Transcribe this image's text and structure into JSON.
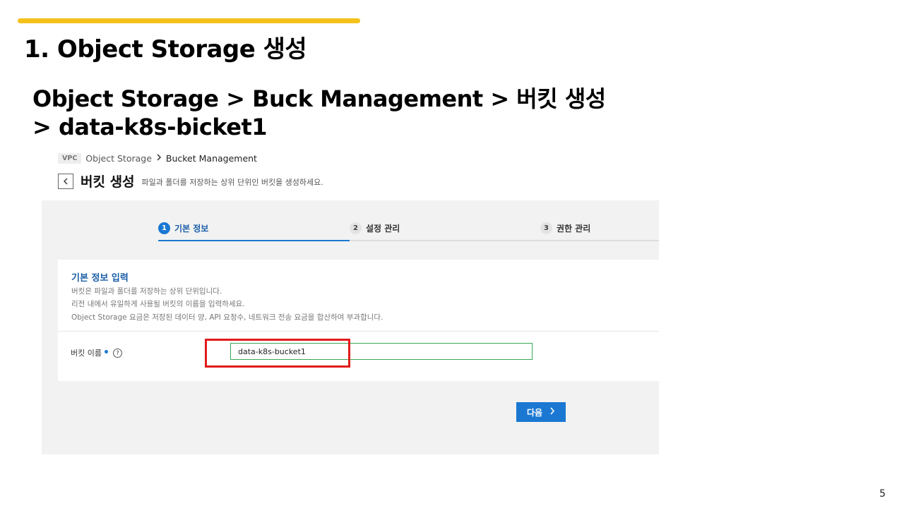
{
  "slide": {
    "title": "1. Object Storage 생성",
    "subtitle_line1": "Object Storage > Buck Management > 버킷 생성",
    "subtitle_line2": "> data-k8s-bicket1",
    "page_number": "5",
    "accent_color": "#f5c21b"
  },
  "breadcrumb": {
    "badge": "VPC",
    "items": [
      "Object Storage",
      "Bucket Management"
    ],
    "separator_icon": "chevron-right-icon"
  },
  "header": {
    "back_icon": "chevron-left-icon",
    "title": "버킷 생성",
    "description": "파일과 폴더를 저장하는 상위 단위인 버킷을 생성하세요."
  },
  "stepper": {
    "steps": [
      {
        "num": "1",
        "label": "기본 정보",
        "active": true
      },
      {
        "num": "2",
        "label": "설정 관리",
        "active": false
      },
      {
        "num": "3",
        "label": "권한 관리",
        "active": false
      }
    ],
    "active_color": "#1a78d2"
  },
  "info": {
    "title": "기본 정보 입력",
    "lines": [
      "버킷은 파일과 폴더를 저장하는 상위 단위입니다.",
      "리전 내에서 유일하게 사용될 버킷의 이름을 입력하세요.",
      "Object Storage 요금은 저장된 데이터 양, API 요청수, 네트워크 전송 요금을 합산하여 부과합니다."
    ]
  },
  "form": {
    "bucket_name_label": "버킷 이름",
    "help_icon": "question-circle-icon",
    "bucket_name_value": "data-k8s-bucket1",
    "input_border_color": "#3aa757"
  },
  "actions": {
    "next_label": "다음",
    "next_icon": "chevron-right-icon"
  },
  "annotation": {
    "highlight_color": "#e21b1b"
  }
}
